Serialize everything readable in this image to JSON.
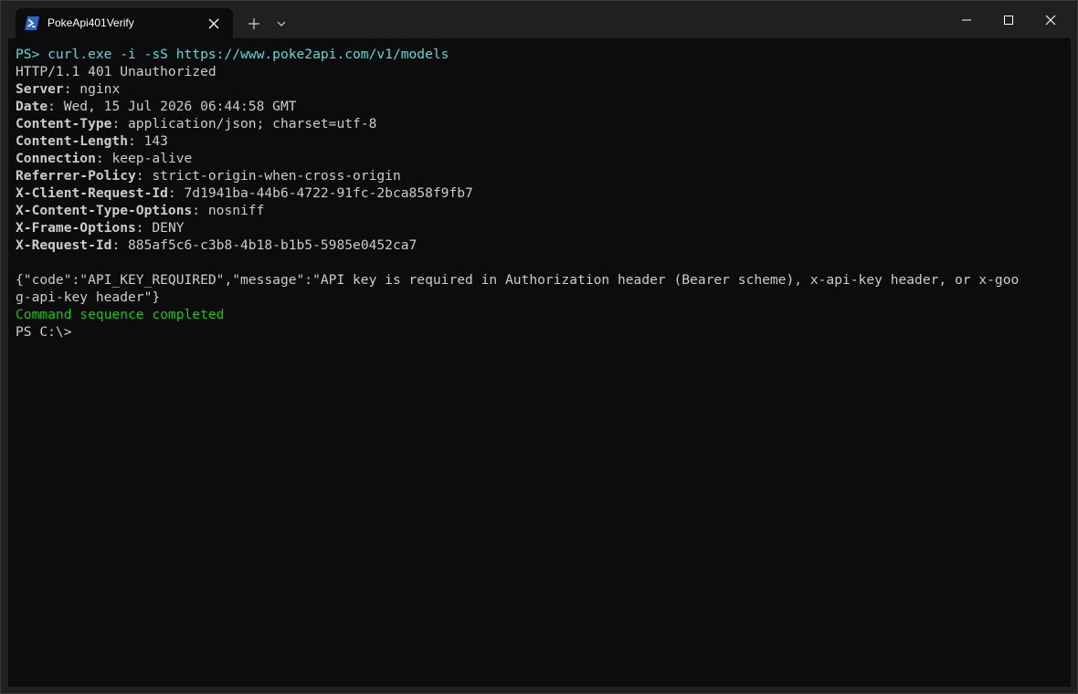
{
  "window": {
    "tab_title": "PokeApi401Verify",
    "tab_icon": "powershell-icon",
    "controls": [
      "minimize-icon",
      "maximize-icon",
      "close-icon"
    ],
    "accent_colors": {
      "background": "#0c0c0c",
      "text": "#cccccc",
      "command": "#61d6d6",
      "success": "#16c60c",
      "powershell_blue": "#2d68c4"
    }
  },
  "terminal": {
    "command_line": "PS> curl.exe -i -sS https://www.poke2api.com/v1/models",
    "status_line": "HTTP/1.1 401 Unauthorized",
    "headers": [
      {
        "name": "Server",
        "value": "nginx"
      },
      {
        "name": "Date",
        "value": "Wed, 15 Jul 2026 06:44:58 GMT"
      },
      {
        "name": "Content-Type",
        "value": "application/json; charset=utf-8"
      },
      {
        "name": "Content-Length",
        "value": "143"
      },
      {
        "name": "Connection",
        "value": "keep-alive"
      },
      {
        "name": "Referrer-Policy",
        "value": "strict-origin-when-cross-origin"
      },
      {
        "name": "X-Client-Request-Id",
        "value": "7d1941ba-44b6-4722-91fc-2bca858f9fb7"
      },
      {
        "name": "X-Content-Type-Options",
        "value": "nosniff"
      },
      {
        "name": "X-Frame-Options",
        "value": "DENY"
      },
      {
        "name": "X-Request-Id",
        "value": "885af5c6-c3b8-4b18-b1b5-5985e0452ca7"
      }
    ],
    "body_lines": [
      "{\"code\":\"API_KEY_REQUIRED\",\"message\":\"API key is required in Authorization header (Bearer scheme), x-api-key header, or x-goo",
      "g-api-key header\"}"
    ],
    "completion_message": "Command sequence completed",
    "prompt": "PS C:\\>"
  }
}
